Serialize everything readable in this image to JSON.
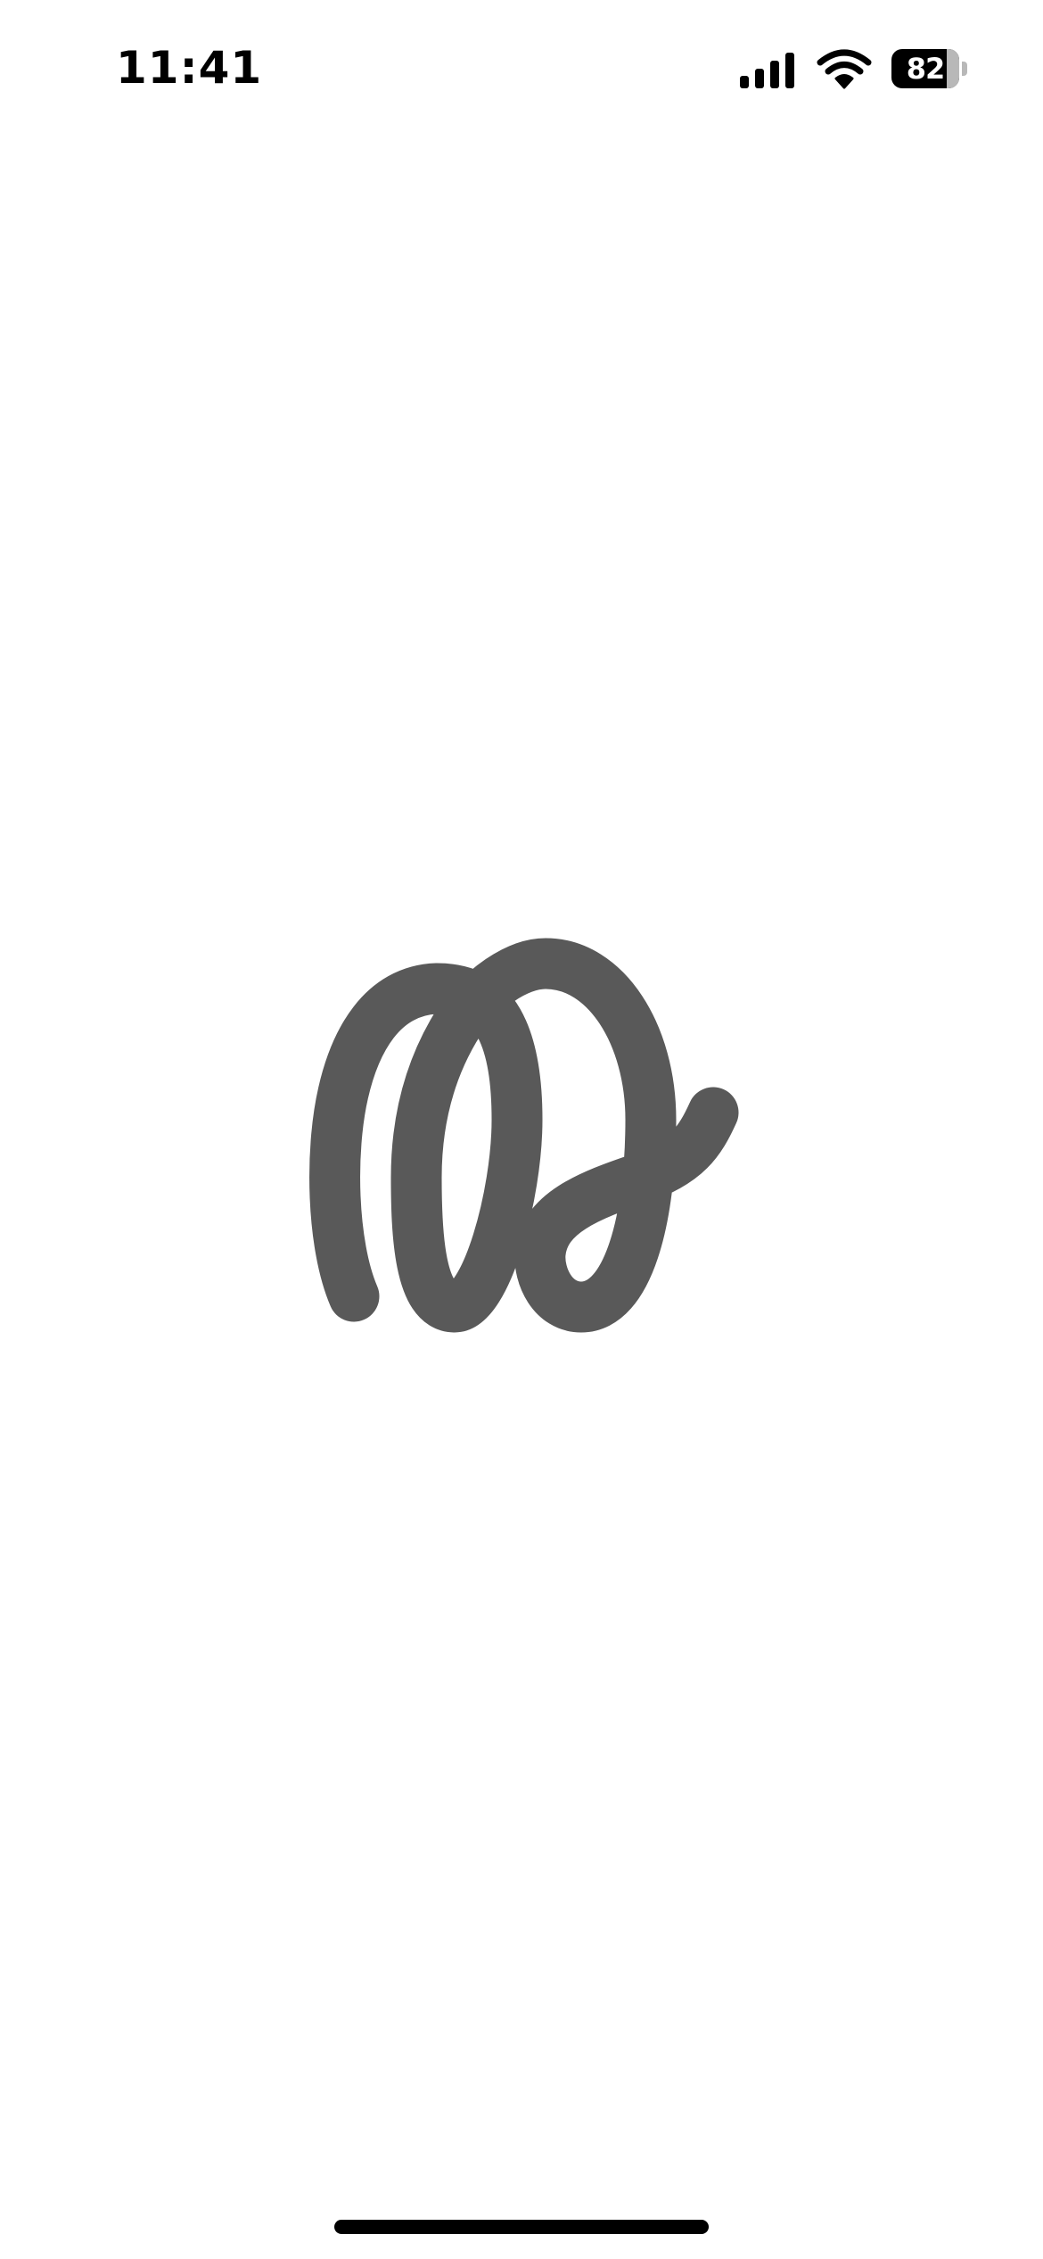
{
  "status_bar": {
    "time": "11:41",
    "battery_level": "82",
    "battery_fraction": 0.82,
    "signal_strength_bars": 4,
    "icons": [
      "cellular-signal-icon",
      "wifi-icon",
      "battery-icon"
    ]
  },
  "splash": {
    "logo_icon": "cursive-script-logo-icon",
    "logo_color": "#595959"
  },
  "colors": {
    "background": "#ffffff",
    "foreground": "#000000"
  }
}
